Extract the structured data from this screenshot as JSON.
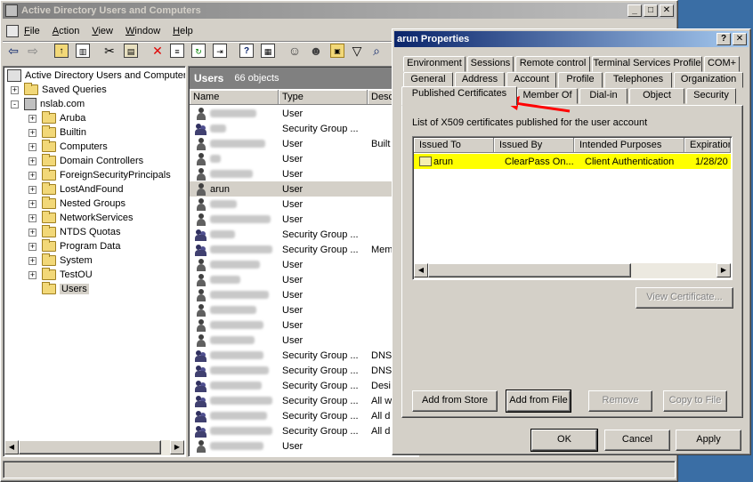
{
  "main_window": {
    "title": "Active Directory Users and Computers",
    "menu": [
      "File",
      "Action",
      "View",
      "Window",
      "Help"
    ],
    "toolbar_icons": [
      "back-icon",
      "forward-icon",
      "up-folder-icon",
      "show-hide-tree-icon",
      "cut-icon",
      "paste-icon",
      "delete-icon",
      "properties-icon",
      "refresh-icon",
      "export-icon",
      "help-icon",
      "console-icon",
      "new-user-icon",
      "new-group-icon",
      "new-ou-icon",
      "filter-icon",
      "find-icon"
    ],
    "tree": {
      "root": "Active Directory Users and Computers",
      "items": [
        {
          "label": "Saved Queries",
          "level": 1,
          "expand": "+"
        },
        {
          "label": "nslab.com",
          "level": 1,
          "expand": "-"
        },
        {
          "label": "Aruba",
          "level": 2,
          "expand": "+"
        },
        {
          "label": "Builtin",
          "level": 2,
          "expand": "+"
        },
        {
          "label": "Computers",
          "level": 2,
          "expand": "+"
        },
        {
          "label": "Domain Controllers",
          "level": 2,
          "expand": "+"
        },
        {
          "label": "ForeignSecurityPrincipals",
          "level": 2,
          "expand": "+"
        },
        {
          "label": "LostAndFound",
          "level": 2,
          "expand": "+"
        },
        {
          "label": "Nested Groups",
          "level": 2,
          "expand": "+"
        },
        {
          "label": "NetworkServices",
          "level": 2,
          "expand": "+"
        },
        {
          "label": "NTDS Quotas",
          "level": 2,
          "expand": "+"
        },
        {
          "label": "Program Data",
          "level": 2,
          "expand": "+"
        },
        {
          "label": "System",
          "level": 2,
          "expand": "+"
        },
        {
          "label": "TestOU",
          "level": 2,
          "expand": "+"
        },
        {
          "label": "Users",
          "level": 2,
          "expand": ""
        }
      ]
    },
    "list": {
      "header_title": "Users",
      "count": "66 objects",
      "columns": [
        "Name",
        "Type",
        "Desc"
      ],
      "rows": [
        {
          "name": "",
          "type": "User",
          "desc": "",
          "icon": "user",
          "name_blur": 52
        },
        {
          "name": "",
          "type": "Security Group ...",
          "desc": "",
          "icon": "group",
          "name_blur": 18
        },
        {
          "name": "",
          "type": "User",
          "desc": "Built",
          "icon": "user",
          "name_blur": 62
        },
        {
          "name": "",
          "type": "User",
          "desc": "",
          "icon": "user",
          "name_blur": 12
        },
        {
          "name": "",
          "type": "User",
          "desc": "",
          "icon": "user",
          "name_blur": 48
        },
        {
          "name": "arun",
          "type": "User",
          "desc": "",
          "icon": "user",
          "name_blur": 0,
          "selected": true
        },
        {
          "name": "",
          "type": "User",
          "desc": "",
          "icon": "user",
          "name_blur": 30
        },
        {
          "name": "",
          "type": "User",
          "desc": "",
          "icon": "user",
          "name_blur": 68
        },
        {
          "name": "",
          "type": "Security Group ...",
          "desc": "",
          "icon": "group",
          "name_blur": 28
        },
        {
          "name": "",
          "type": "Security Group ...",
          "desc": "Mem",
          "icon": "group",
          "name_blur": 70
        },
        {
          "name": "",
          "type": "User",
          "desc": "",
          "icon": "user",
          "name_blur": 56
        },
        {
          "name": "",
          "type": "User",
          "desc": "",
          "icon": "user",
          "name_blur": 34
        },
        {
          "name": "",
          "type": "User",
          "desc": "",
          "icon": "user",
          "name_blur": 66
        },
        {
          "name": "",
          "type": "User",
          "desc": "",
          "icon": "user",
          "name_blur": 52
        },
        {
          "name": "",
          "type": "User",
          "desc": "",
          "icon": "user",
          "name_blur": 60
        },
        {
          "name": "",
          "type": "User",
          "desc": "",
          "icon": "user",
          "name_blur": 50
        },
        {
          "name": "",
          "type": "Security Group ...",
          "desc": "DNS",
          "icon": "group",
          "name_blur": 60
        },
        {
          "name": "",
          "type": "Security Group ...",
          "desc": "DNS",
          "icon": "group",
          "name_blur": 66
        },
        {
          "name": "",
          "type": "Security Group ...",
          "desc": "Desi",
          "icon": "group",
          "name_blur": 58
        },
        {
          "name": "",
          "type": "Security Group ...",
          "desc": "All w",
          "icon": "group",
          "name_blur": 70
        },
        {
          "name": "",
          "type": "Security Group ...",
          "desc": "All d",
          "icon": "group",
          "name_blur": 64
        },
        {
          "name": "",
          "type": "Security Group ...",
          "desc": "All d",
          "icon": "group",
          "name_blur": 70
        },
        {
          "name": "",
          "type": "User",
          "desc": "",
          "icon": "user",
          "name_blur": 60
        }
      ]
    }
  },
  "dialog": {
    "title": "arun Properties",
    "tabs_row1": [
      "Environment",
      "Sessions",
      "Remote control",
      "Terminal Services Profile",
      "COM+"
    ],
    "tabs_row2": [
      "General",
      "Address",
      "Account",
      "Profile",
      "Telephones",
      "Organization"
    ],
    "tabs_row3": [
      "Published Certificates",
      "Member Of",
      "Dial-in",
      "Object",
      "Security"
    ],
    "active_tab": "Published Certificates",
    "description": "List of X509 certificates published for the user account",
    "cert_columns": [
      "Issued To",
      "Issued By",
      "Intended Purposes",
      "Expiration"
    ],
    "cert_rows": [
      {
        "issued_to": "arun",
        "issued_by": "ClearPass On...",
        "purposes": "Client Authentication",
        "expiration": "1/28/20"
      }
    ],
    "buttons": {
      "view_certificate": "View Certificate...",
      "add_from_store": "Add from Store",
      "add_from_file": "Add from File",
      "remove": "Remove",
      "copy_to_file": "Copy to File",
      "ok": "OK",
      "cancel": "Cancel",
      "apply": "Apply"
    }
  },
  "colors": {
    "title_active_start": "#0a246a",
    "title_active_end": "#a6caf0",
    "title_inactive_start": "#808080",
    "title_inactive_end": "#c0c0c0",
    "highlight": "#ffff00",
    "annotation_arrow": "#ff0000"
  }
}
